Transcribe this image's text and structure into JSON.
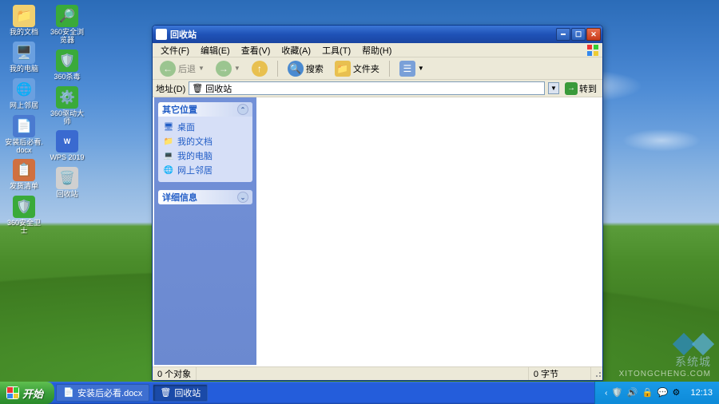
{
  "desktop_icons": {
    "col1": [
      "我的文档",
      "我的电脑",
      "网上邻居",
      "安装后必看.docx",
      "发货清单",
      "360安全卫士"
    ],
    "col2": [
      "360安全浏览器",
      "360杀毒",
      "360驱动大师",
      "WPS 2019",
      "回收站"
    ]
  },
  "window": {
    "title": "回收站",
    "menu": [
      "文件(F)",
      "编辑(E)",
      "查看(V)",
      "收藏(A)",
      "工具(T)",
      "帮助(H)"
    ],
    "toolbar": {
      "back": "后退",
      "search": "搜索",
      "folders": "文件夹"
    },
    "address": {
      "label": "地址(D)",
      "value": "回收站",
      "go": "转到"
    },
    "sidepanel": {
      "group1": {
        "title": "其它位置",
        "links": [
          "桌面",
          "我的文档",
          "我的电脑",
          "网上邻居"
        ]
      },
      "group2": {
        "title": "详细信息"
      }
    },
    "status": {
      "left": "0 个对象",
      "right": "0 字节"
    }
  },
  "taskbar": {
    "start": "开始",
    "items": [
      "安装后必看.docx",
      "回收站"
    ],
    "clock": "12:13"
  },
  "watermark": {
    "brand": "系统城",
    "url": "XITONGCHENG.COM"
  }
}
